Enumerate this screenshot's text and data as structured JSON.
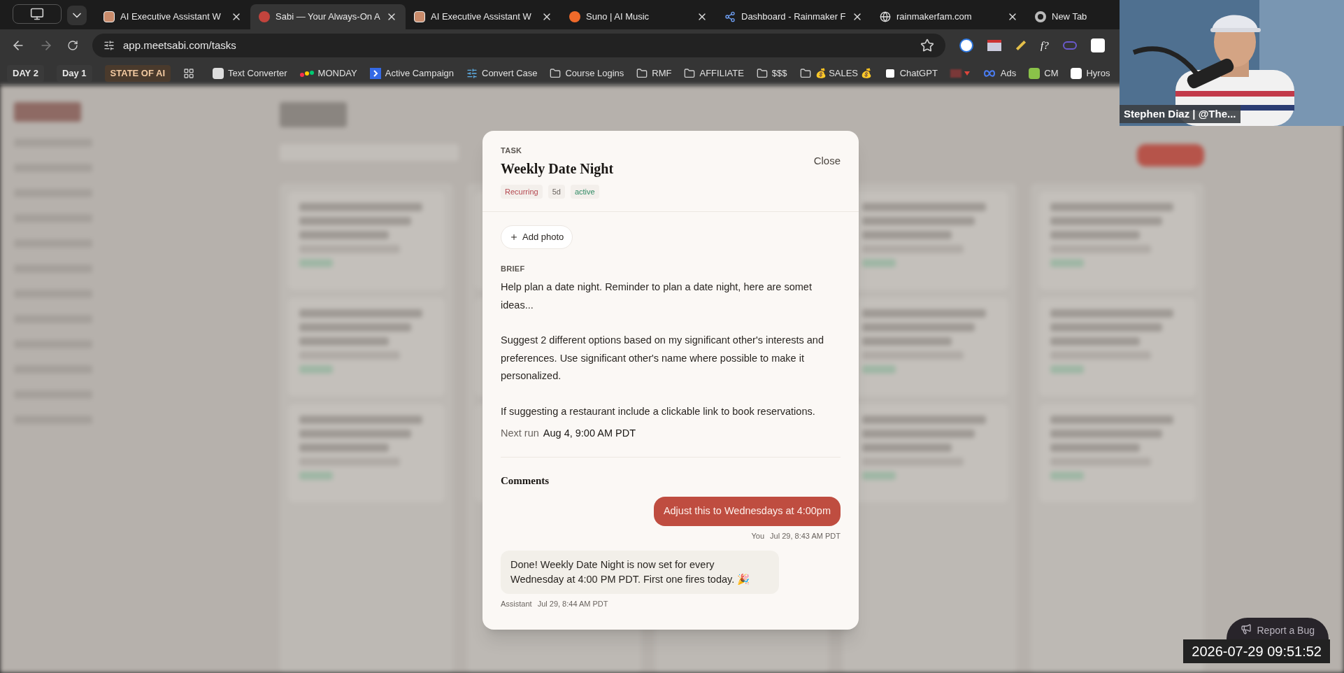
{
  "browser": {
    "tabs": [
      {
        "title": "AI Executive Assistant W",
        "selected": false,
        "closable": true
      },
      {
        "title": "Sabi — Your Always-On A",
        "selected": true,
        "closable": true
      },
      {
        "title": "AI Executive Assistant W",
        "selected": false,
        "closable": true
      },
      {
        "title": "Suno | AI Music",
        "selected": false,
        "closable": true
      },
      {
        "title": "Dashboard - Rainmaker F",
        "selected": false,
        "closable": true
      },
      {
        "title": "rainmakerfam.com",
        "selected": false,
        "closable": true
      },
      {
        "title": "New Tab",
        "selected": false,
        "closable": false
      }
    ],
    "address": "app.meetsabi.com/tasks",
    "extension_label": "f?",
    "bookmarks": [
      {
        "kind": "chip",
        "label": "DAY 2"
      },
      {
        "kind": "chip",
        "label": "Day 1"
      },
      {
        "kind": "accent_chip",
        "label": "STATE OF AI"
      },
      {
        "kind": "apps"
      },
      {
        "kind": "link",
        "label": "Text Converter"
      },
      {
        "kind": "link",
        "label": "MONDAY"
      },
      {
        "kind": "link",
        "label": "Active Campaign"
      },
      {
        "kind": "link",
        "label": "Convert Case"
      },
      {
        "kind": "folder",
        "label": "Course Logins"
      },
      {
        "kind": "folder",
        "label": "RMF"
      },
      {
        "kind": "folder",
        "label": "AFFILIATE"
      },
      {
        "kind": "folder",
        "label": "$$$"
      },
      {
        "kind": "folder",
        "label": "💰 SALES 💰"
      },
      {
        "kind": "link",
        "label": "ChatGPT"
      },
      {
        "kind": "hidden"
      },
      {
        "kind": "link",
        "label": "Ads"
      },
      {
        "kind": "link",
        "label": "CM"
      },
      {
        "kind": "link",
        "label": "Hyros"
      }
    ]
  },
  "modal": {
    "eyebrow": "TASK",
    "title": "Weekly Date Night",
    "close": "Close",
    "tags": [
      {
        "label": "Recurring",
        "color": "#b4474f"
      },
      {
        "label": "5d",
        "color": "#6b6560"
      },
      {
        "label": "active",
        "color": "#2f8a63"
      }
    ],
    "add_photo": "Add photo",
    "brief_label": "BRIEF",
    "brief": [
      "Help plan a date night. Reminder to plan a date night, here are somet ideas...",
      "Suggest 2 different options based on my significant other's interests and preferences. Use significant other's name where possible to make it personalized.",
      "If suggesting a restaurant include a clickable link to book reservations."
    ],
    "next_run": {
      "label": "Next run",
      "value": "Aug 4, 9:00 AM PDT"
    },
    "comments_title": "Comments",
    "comments": [
      {
        "kind": "user",
        "text": "Adjust this to Wednesdays at 4:00pm",
        "author": "You",
        "time": "Jul 29, 8:43 AM PDT"
      },
      {
        "kind": "assistant",
        "text": "Done! Weekly Date Night is now set for every Wednesday at 4:00 PM PDT. First one fires today. 🎉",
        "author": "Assistant",
        "time": "Jul 29, 8:44 AM PDT"
      }
    ]
  },
  "webcam": {
    "name_label": "Stephen Diaz | @The..."
  },
  "report_bug": "Report a Bug",
  "timestamp": "2026-07-29 09:51:52"
}
